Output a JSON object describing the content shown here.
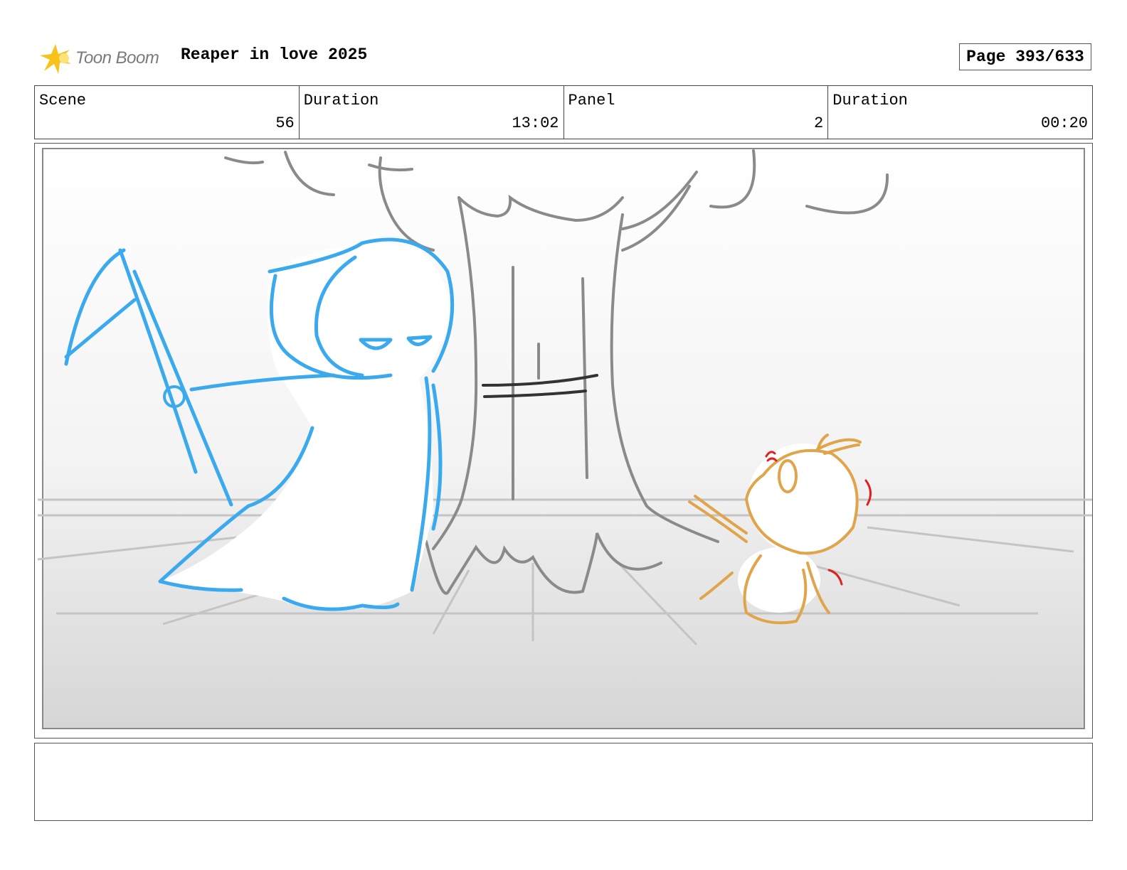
{
  "header": {
    "logo_text": "Toon Boom",
    "title": "Reaper in love 2025",
    "page": "Page 393/633"
  },
  "info": {
    "scene_label": "Scene",
    "scene_value": "56",
    "duration_label": "Duration",
    "duration_value": "13:02",
    "panel_label": "Panel",
    "panel_value": "2",
    "panel_duration_label": "Duration",
    "panel_duration_value": "00:20"
  },
  "colors": {
    "reaper": "#3aa9ee",
    "creature": "#e0a44a",
    "tree": "#8a8a8a",
    "accent_red": "#e02020",
    "logo_yellow": "#f7c21a"
  },
  "notes": ""
}
